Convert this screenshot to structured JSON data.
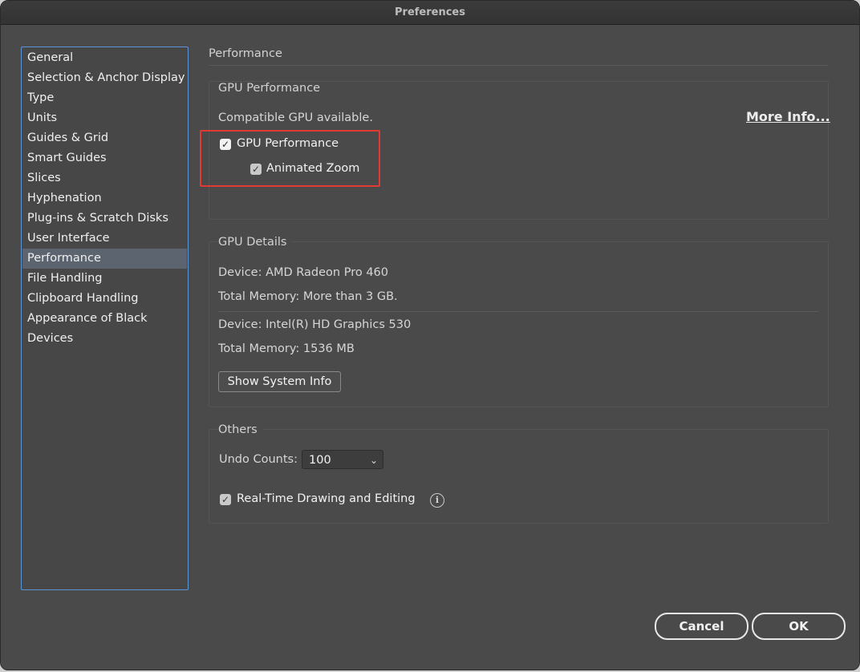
{
  "window": {
    "title": "Preferences"
  },
  "sidebar": {
    "items": [
      {
        "label": "General"
      },
      {
        "label": "Selection & Anchor Display"
      },
      {
        "label": "Type"
      },
      {
        "label": "Units"
      },
      {
        "label": "Guides & Grid"
      },
      {
        "label": "Smart Guides"
      },
      {
        "label": "Slices"
      },
      {
        "label": "Hyphenation"
      },
      {
        "label": "Plug-ins & Scratch Disks"
      },
      {
        "label": "User Interface"
      },
      {
        "label": "Performance"
      },
      {
        "label": "File Handling"
      },
      {
        "label": "Clipboard Handling"
      },
      {
        "label": "Appearance of Black"
      },
      {
        "label": "Devices"
      }
    ],
    "selected": "Performance"
  },
  "main": {
    "heading": "Performance",
    "gpu_performance": {
      "heading": "GPU Performance",
      "status": "Compatible GPU available.",
      "more_info": "More Info...",
      "gpu_checkbox": {
        "label": "GPU Performance",
        "checked": true
      },
      "zoom_checkbox": {
        "label": "Animated Zoom",
        "checked": true
      }
    },
    "gpu_details": {
      "heading": "GPU Details",
      "device1": "Device: AMD Radeon Pro 460",
      "memory1": "Total Memory:  More than 3 GB.",
      "device2": "Device: Intel(R) HD Graphics 530",
      "memory2": "Total Memory: 1536 MB",
      "show_system_info": "Show System Info"
    },
    "others": {
      "heading": "Others",
      "undo_label": "Undo Counts:",
      "undo_value": "100",
      "realtime": {
        "label": "Real-Time Drawing and Editing",
        "checked": true
      }
    }
  },
  "footer": {
    "cancel": "Cancel",
    "ok": "OK"
  },
  "colors": {
    "highlight": "#e03a32",
    "selection_border": "#5b95d6"
  }
}
